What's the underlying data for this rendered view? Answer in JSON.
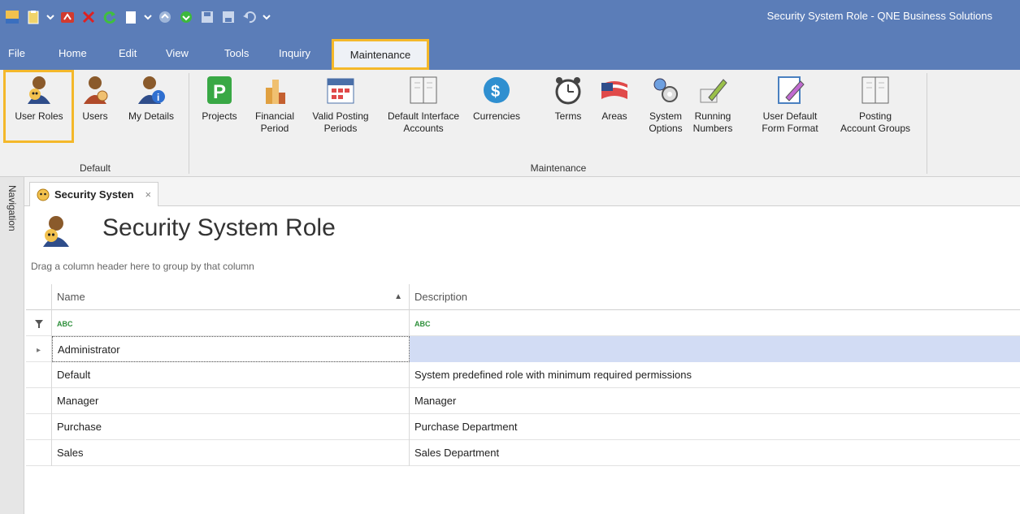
{
  "window": {
    "title": "Security System Role - QNE Business Solutions"
  },
  "quick_access": [
    "app-icon",
    "clipboard-icon",
    "chevron-down-icon",
    "red-folder-icon",
    "delete-x-icon",
    "refresh-icon",
    "new-doc-icon",
    "chevron-down-icon",
    "up-circle-icon",
    "down-circle-icon",
    "save-icon",
    "save-all-icon",
    "undo-icon",
    "chevron-down-icon"
  ],
  "menu": {
    "tabs": [
      "File",
      "Home",
      "Edit",
      "View",
      "Tools",
      "Inquiry",
      "Maintenance"
    ],
    "active": "Maintenance"
  },
  "ribbon": {
    "default_group": {
      "label": "Default",
      "items": [
        {
          "label": "User Roles",
          "icon": "user-roles-icon"
        },
        {
          "label": "Users",
          "icon": "users-icon"
        },
        {
          "label": "My Details",
          "icon": "my-details-icon"
        }
      ]
    },
    "maintenance_group": {
      "label": "Maintenance",
      "items": [
        {
          "line1": "Projects",
          "line2": "",
          "icon": "projects-icon"
        },
        {
          "line1": "Financial",
          "line2": "Period",
          "icon": "financial-period-icon"
        },
        {
          "line1": "Valid Posting",
          "line2": "Periods",
          "icon": "calendar-icon"
        },
        {
          "line1": "Default Interface",
          "line2": "Accounts",
          "icon": "book-icon"
        },
        {
          "line1": "Currencies",
          "line2": "",
          "icon": "dollar-icon"
        },
        {
          "line1": "Terms",
          "line2": "",
          "icon": "clock-icon"
        },
        {
          "line1": "Areas",
          "line2": "",
          "icon": "flag-icon"
        },
        {
          "line1": "System",
          "line2": "Options",
          "icon": "gears-icon"
        },
        {
          "line1": "Running",
          "line2": "Numbers",
          "icon": "pencil-icon"
        },
        {
          "line1": "User Default",
          "line2": "Form Format",
          "icon": "form-edit-icon"
        },
        {
          "line1": "Posting",
          "line2": "Account Groups",
          "icon": "book-icon"
        }
      ]
    }
  },
  "navigation": {
    "label": "Navigation"
  },
  "document_tab": {
    "label": "Security Systen",
    "close": "×"
  },
  "page": {
    "title": "Security System Role",
    "group_hint": "Drag a column header here to group by that column"
  },
  "grid": {
    "columns": [
      "Name",
      "Description"
    ],
    "filter_glyph": "ABC",
    "rows": [
      {
        "name": "Administrator",
        "description": ""
      },
      {
        "name": "Default",
        "description": "System predefined role with minimum required permissions"
      },
      {
        "name": "Manager",
        "description": "Manager"
      },
      {
        "name": "Purchase",
        "description": "Purchase Department"
      },
      {
        "name": "Sales",
        "description": "Sales Department"
      }
    ]
  },
  "colors": {
    "titlebar": "#5b7db8",
    "highlight": "#f4b82a",
    "selected_row": "#d2dcf4"
  }
}
